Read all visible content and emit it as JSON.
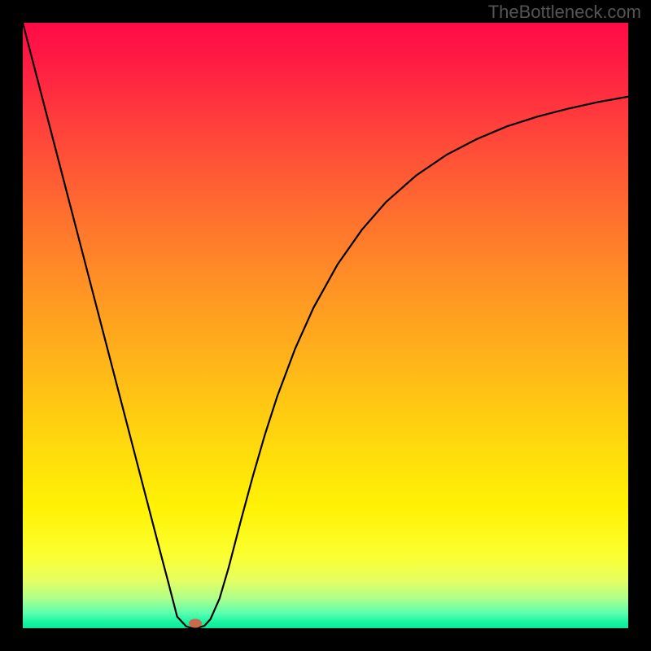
{
  "watermark": "TheBottleneck.com",
  "colors": {
    "frame": "#000000",
    "curve": "#000000",
    "marker": "#c96a4f",
    "gradient_top": "#ff0b47",
    "gradient_bottom": "#0fe59a"
  },
  "chart_data": {
    "type": "line",
    "title": "",
    "xlabel": "",
    "ylabel": "",
    "x_range": [
      0,
      100
    ],
    "y_range": [
      0,
      100
    ],
    "x": [
      0,
      4,
      8,
      12,
      16,
      20,
      22.5,
      24,
      25.5,
      27,
      28,
      29,
      30,
      31,
      32.5,
      34,
      36,
      38,
      40,
      42,
      45,
      48,
      52,
      56,
      60,
      65,
      70,
      75,
      80,
      85,
      90,
      95,
      100
    ],
    "y": [
      100,
      84.6,
      69.2,
      53.8,
      38.4,
      23.0,
      13.4,
      7.7,
      1.9,
      0.3,
      0.0,
      0.1,
      0.4,
      1.5,
      4.9,
      10.0,
      17.7,
      25.1,
      32.0,
      38.2,
      46.2,
      52.9,
      60.1,
      65.8,
      70.4,
      74.8,
      78.2,
      80.8,
      82.9,
      84.5,
      85.8,
      86.9,
      87.8
    ],
    "marker": {
      "x": 28.5,
      "y": 0.8
    },
    "annotations": []
  }
}
